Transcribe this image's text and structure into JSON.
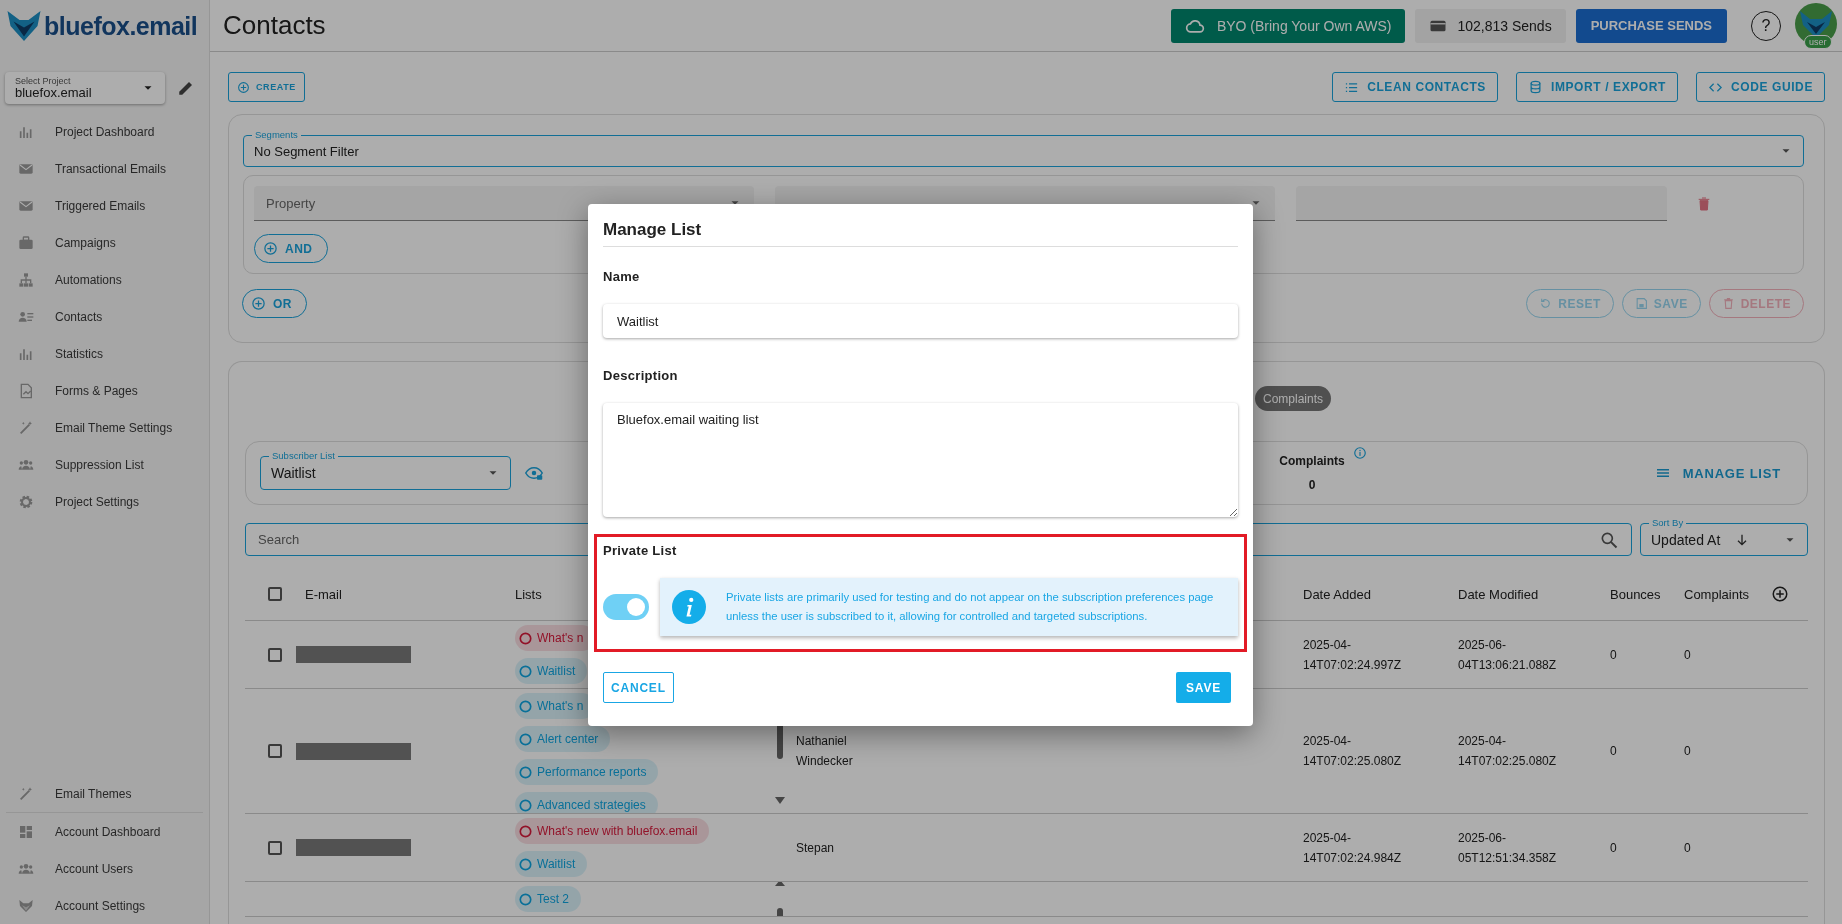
{
  "sidebar": {
    "logo": "bluefox.email",
    "project_select": {
      "label": "Select Project",
      "value": "bluefox.email"
    },
    "items": [
      {
        "label": "Project Dashboard",
        "selected": false
      },
      {
        "label": "Transactional Emails",
        "selected": false
      },
      {
        "label": "Triggered Emails",
        "selected": false
      },
      {
        "label": "Campaigns",
        "selected": false
      },
      {
        "label": "Automations",
        "selected": false
      },
      {
        "label": "Contacts",
        "selected": false
      },
      {
        "label": "Statistics",
        "selected": false
      },
      {
        "label": "Forms & Pages",
        "selected": false
      },
      {
        "label": "Email Theme Settings",
        "selected": false
      },
      {
        "label": "Suppression List",
        "selected": false
      },
      {
        "label": "Project Settings",
        "selected": false
      }
    ],
    "footer_items": [
      {
        "label": "Email Themes",
        "selected": false
      },
      {
        "label": "Account Dashboard",
        "selected": false
      },
      {
        "label": "Account Users",
        "selected": false
      },
      {
        "label": "Account Settings",
        "selected": false
      }
    ]
  },
  "header": {
    "title": "Contacts",
    "byo_button": "BYO (Bring Your Own AWS)",
    "sends": "102,813 Sends",
    "purchase_button": "PURCHASE SENDS",
    "help": "?",
    "avatar_badge": "user"
  },
  "toolbar": {
    "create": "CREATE",
    "actions": [
      "CLEAN CONTACTS",
      "IMPORT / EXPORT",
      "CODE GUIDE"
    ]
  },
  "filters": {
    "segments": {
      "label": "Segments",
      "value": "No Segment Filter"
    },
    "property": {
      "placeholder": "Property"
    },
    "and": "AND",
    "or": "OR",
    "actions": [
      {
        "label": "RESET",
        "kind": "reset",
        "disabled": true
      },
      {
        "label": "SAVE",
        "kind": "save",
        "disabled": true
      },
      {
        "label": "DELETE",
        "kind": "delete",
        "disabled": true
      }
    ]
  },
  "contacts": {
    "tab": "Complaints",
    "subscriber_list": {
      "label": "Subscriber List",
      "value": "Waitlist"
    },
    "stat": {
      "label": "Complaints",
      "value": "0"
    },
    "manage_list": "MANAGE LIST",
    "search": {
      "placeholder": "Search"
    },
    "sort": {
      "label": "Sort By",
      "value": "Updated At"
    },
    "header_checked": false,
    "columns": [
      "E-mail",
      "Lists",
      "Date Added",
      "Date Modified",
      "Bounces",
      "Complaints"
    ],
    "rows": [
      {
        "checked": false,
        "scrollable": false,
        "lists": [
          {
            "label": "What's n",
            "kind": "unsubscribed"
          },
          {
            "label": "Waitlist",
            "kind": "subscribed"
          }
        ],
        "date_added": "2025-04-14T07:02:24.997Z",
        "date_modified": "2025-06-04T13:06:21.088Z",
        "bounces": "0",
        "complaints": "0"
      },
      {
        "checked": false,
        "scrollable": true,
        "name": "Nathaniel Windecker",
        "lists": [
          {
            "label": "What's n",
            "kind": "subscribed"
          },
          {
            "label": "Alert center",
            "kind": "subscribed"
          },
          {
            "label": "Performance reports",
            "kind": "subscribed"
          },
          {
            "label": "Advanced strategies",
            "kind": "subscribed"
          }
        ],
        "date_added": "2025-04-14T07:02:25.080Z",
        "date_modified": "2025-04-14T07:02:25.080Z",
        "bounces": "0",
        "complaints": "0"
      },
      {
        "checked": false,
        "scrollable": false,
        "name": "Stepan",
        "lists": [
          {
            "label": "What's new with bluefox.email",
            "kind": "unsubscribed"
          },
          {
            "label": "Waitlist",
            "kind": "subscribed"
          }
        ],
        "date_added": "2025-04-14T07:02:24.984Z",
        "date_modified": "2025-06-05T12:51:34.358Z",
        "bounces": "0",
        "complaints": "0"
      },
      {
        "scrollable": true,
        "lists": [
          {
            "label": "Test 2",
            "kind": "subscribed"
          }
        ]
      }
    ]
  },
  "modal": {
    "title": "Manage List",
    "name": {
      "label": "Name",
      "value": "Waitlist"
    },
    "description": {
      "label": "Description",
      "value": "Bluefox.email waiting list"
    },
    "private": {
      "label": "Private List",
      "on": true,
      "info": "Private lists are primarily used for testing and do not appear on the subscription preferences page unless the user is subscribed to it, allowing for controlled and targeted subscriptions."
    },
    "cancel": "CANCEL",
    "save": "SAVE"
  }
}
